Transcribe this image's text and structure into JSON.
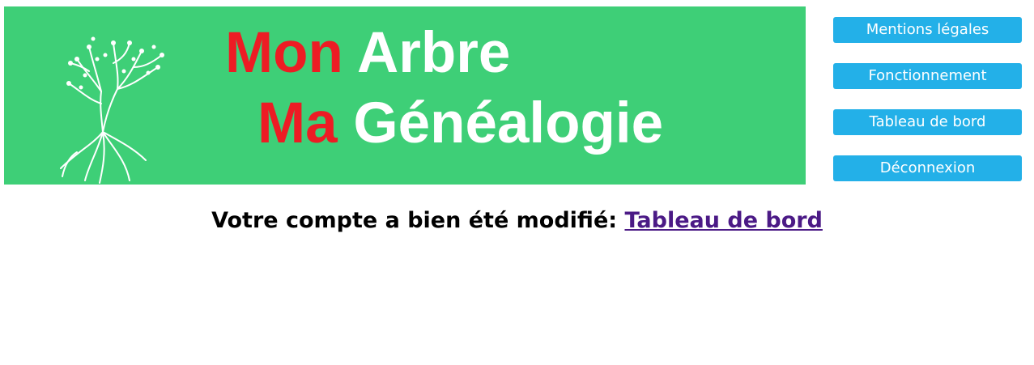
{
  "banner": {
    "background": "#3ecf77",
    "logo_icon": "tree-icon",
    "line1": {
      "red": "Mon",
      "white": "Arbre"
    },
    "line2": {
      "red": "Ma",
      "white": "Généalogie"
    },
    "accent_red": "#ed1c24"
  },
  "menu": {
    "button_color": "#23b0e8",
    "items": [
      {
        "label": "Mentions légales"
      },
      {
        "label": "Fonctionnement"
      },
      {
        "label": "Tableau de bord"
      },
      {
        "label": "Déconnexion"
      }
    ]
  },
  "message": {
    "text": "Votre compte a bien été modifié:",
    "link_label": "Tableau de bord",
    "link_color": "#4b1a86"
  }
}
